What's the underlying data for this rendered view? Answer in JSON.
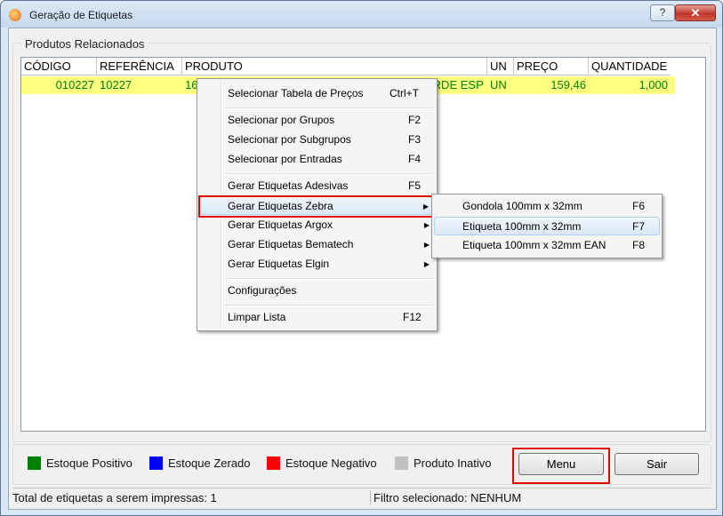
{
  "window": {
    "title": "Geração de Etiquetas",
    "help_label": "?",
    "close_label": "✕"
  },
  "group": {
    "label": "Produtos Relacionados"
  },
  "grid": {
    "headers": [
      "CÓDIGO",
      "REFERÊNCIA",
      "PRODUTO",
      "UN",
      "PREÇO",
      "QUANTIDADE"
    ],
    "rows": [
      {
        "codigo": "010227",
        "referencia": "10227",
        "produto": "163 CAIOLA ESMERALDA CALOR - BX P. 7 VERDE ESP",
        "un": "UN",
        "preco": "159,46",
        "quantidade": "1,000"
      }
    ]
  },
  "context_menu": {
    "items": [
      {
        "label": "Selecionar Tabela de Preços",
        "shortcut": "Ctrl+T"
      },
      {
        "label": "Selecionar por Grupos",
        "shortcut": "F2"
      },
      {
        "label": "Selecionar por Subgrupos",
        "shortcut": "F3"
      },
      {
        "label": "Selecionar por Entradas",
        "shortcut": "F4"
      },
      {
        "label": "Gerar Etiquetas Adesivas",
        "shortcut": "F5"
      },
      {
        "label": "Gerar Etiquetas Zebra",
        "shortcut": ""
      },
      {
        "label": "Gerar Etiquetas Argox",
        "shortcut": ""
      },
      {
        "label": "Gerar Etiquetas Bematech",
        "shortcut": ""
      },
      {
        "label": "Gerar Etiquetas Elgin",
        "shortcut": ""
      },
      {
        "label": "Configurações",
        "shortcut": ""
      },
      {
        "label": "Limpar Lista",
        "shortcut": "F12"
      }
    ]
  },
  "submenu": {
    "items": [
      {
        "label": "Gondola 100mm x 32mm",
        "shortcut": "F6"
      },
      {
        "label": "Etiqueta 100mm x 32mm",
        "shortcut": "F7"
      },
      {
        "label": "Etiqueta 100mm x 32mm EAN",
        "shortcut": "F8"
      }
    ]
  },
  "legend": {
    "items": [
      {
        "label": "Estoque Positivo",
        "color": "#008000"
      },
      {
        "label": "Estoque Zerado",
        "color": "#0000ff"
      },
      {
        "label": "Estoque Negativo",
        "color": "#ff0000"
      },
      {
        "label": "Produto Inativo",
        "color": "#c0c0c0"
      }
    ]
  },
  "buttons": {
    "menu": "Menu",
    "sair": "Sair"
  },
  "status": {
    "total": "Total de etiquetas a serem impressas: 1",
    "filter": "Filtro selecionado: NENHUM"
  },
  "colors": {
    "highlight_outline": "#e00000",
    "row_highlight": "#ffff80",
    "row_text": "#008000"
  }
}
